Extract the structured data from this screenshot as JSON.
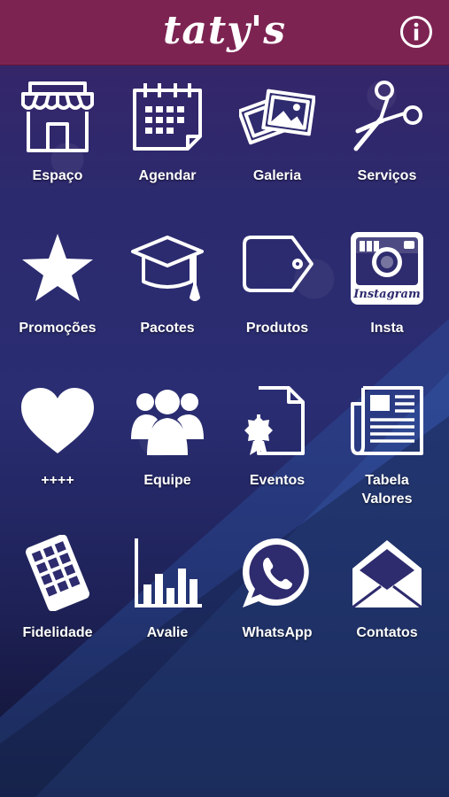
{
  "app": {
    "title": "taty's"
  },
  "header": {
    "info_icon": "info-circle-icon"
  },
  "tiles": [
    {
      "label": "Espaço",
      "icon": "storefront-icon"
    },
    {
      "label": "Agendar",
      "icon": "calendar-icon"
    },
    {
      "label": "Galeria",
      "icon": "photos-icon"
    },
    {
      "label": "Serviços",
      "icon": "scissors-icon"
    },
    {
      "label": "Promoções",
      "icon": "star-icon"
    },
    {
      "label": "Pacotes",
      "icon": "graduation-cap-icon"
    },
    {
      "label": "Produtos",
      "icon": "price-tag-icon"
    },
    {
      "label": "Insta",
      "icon": "instagram-icon",
      "icon_text": "Instagram"
    },
    {
      "label": "++++",
      "icon": "heart-icon"
    },
    {
      "label": "Equipe",
      "icon": "team-icon"
    },
    {
      "label": "Eventos",
      "icon": "certificate-icon"
    },
    {
      "label": "Tabela\nValores",
      "icon": "newspaper-icon"
    },
    {
      "label": "Fidelidade",
      "icon": "loyalty-card-icon"
    },
    {
      "label": "Avalie",
      "icon": "bar-chart-icon"
    },
    {
      "label": "WhatsApp",
      "icon": "whatsapp-icon"
    },
    {
      "label": "Contatos",
      "icon": "envelope-icon"
    }
  ],
  "colors": {
    "header": "#7d2352",
    "background_top": "#3a2468",
    "background_bottom": "#10122e",
    "icon": "#ffffff"
  }
}
